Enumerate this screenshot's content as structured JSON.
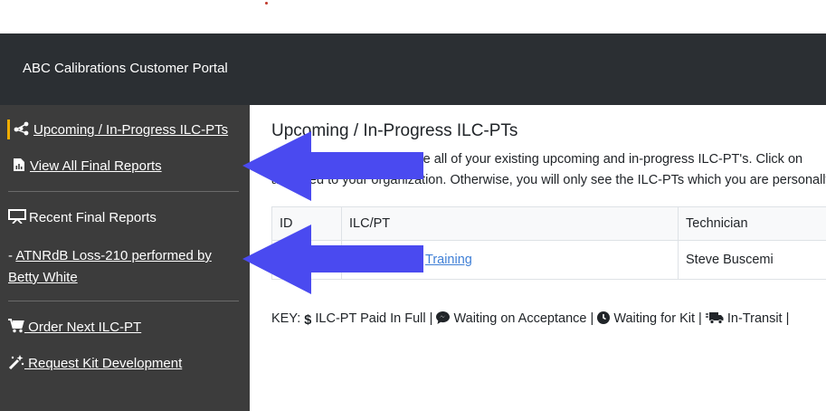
{
  "header": {
    "title": "ABC Calibrations Customer Portal"
  },
  "sidebar": {
    "items": [
      {
        "label": "Upcoming / In-Progress ILC-PTs",
        "icon": "network-icon"
      },
      {
        "label": "View All Final Reports",
        "icon": "report-icon"
      },
      {
        "label": "Recent Final Reports",
        "icon": "presentation-icon"
      },
      {
        "prefix": "- ",
        "label_line1": "ATNRdB Loss-210 performed by",
        "label_line2": "Betty White"
      },
      {
        "label": " Order Next ILC-PT",
        "icon": "cart-icon"
      },
      {
        "label": " Request Kit Development",
        "icon": "magic-wand-icon"
      }
    ]
  },
  "main": {
    "title": "Upcoming / In-Progress ILC-PTs",
    "desc_line1_a": "Here you can view/manage all of your existing upcoming and in-progress ILC-PT's. Click on",
    "desc_line2": "assigned to your organization. Otherwise, you will only see the ILC-PTs which you are personally",
    "table": {
      "headers": [
        "ID",
        "ILC/PT",
        "Technician"
      ],
      "rows": [
        {
          "id": "",
          "ilc": "Training",
          "tech": "Steve Buscemi"
        }
      ]
    },
    "key": {
      "label": "KEY:",
      "items": [
        "ILC-PT Paid In Full",
        "Waiting on Acceptance",
        "Waiting for Kit",
        "In-Transit"
      ]
    }
  },
  "colors": {
    "arrow": "#4a4af0",
    "header_bg": "#2b2f33",
    "sidebar_bg": "#3c3c3c",
    "active": "#f0ad00"
  }
}
